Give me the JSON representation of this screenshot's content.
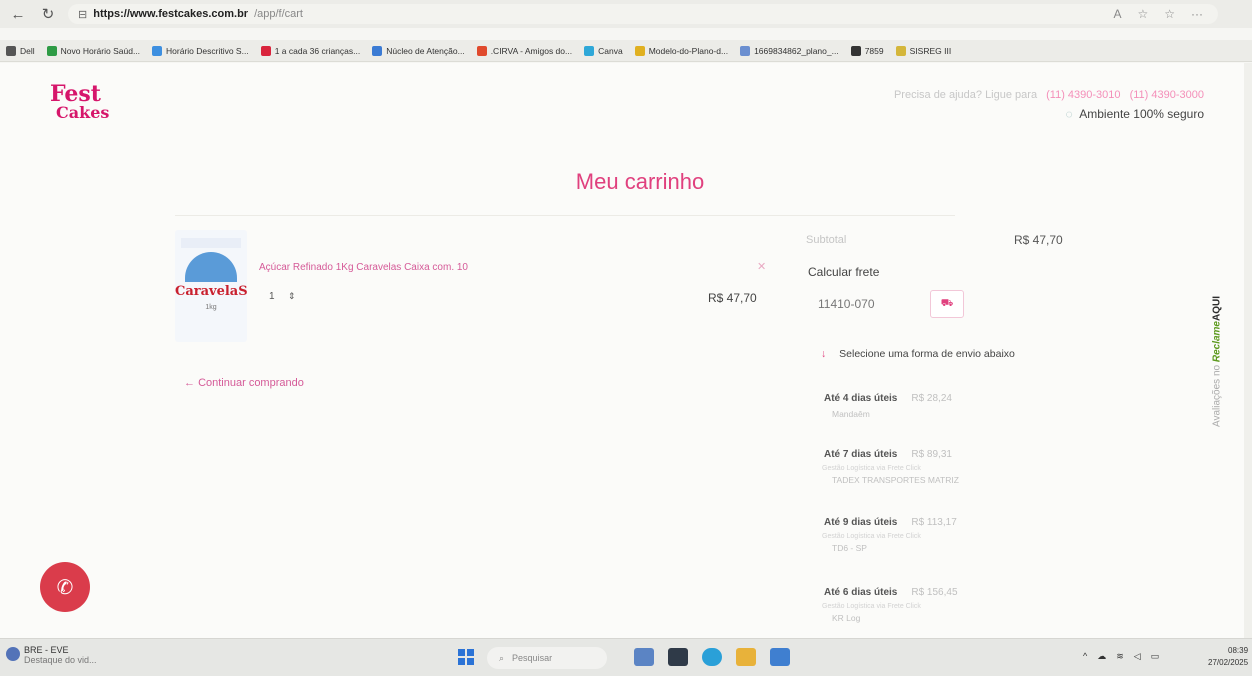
{
  "browser": {
    "url_host": "https://www.festcakes.com.br",
    "url_path": "/app/f/cart",
    "bookmarks": [
      {
        "label": "Dell",
        "color": "#555555"
      },
      {
        "label": "Novo Horário Saúd...",
        "color": "#2e9b45"
      },
      {
        "label": "Horário Descritivo S...",
        "color": "#3d8fe0"
      },
      {
        "label": "1 a cada 36 crianças...",
        "color": "#d9243c"
      },
      {
        "label": "Núcleo de Atenção...",
        "color": "#3b7bd4"
      },
      {
        "label": ".CIRVA - Amigos do...",
        "color": "#e04a2d"
      },
      {
        "label": "Canva",
        "color": "#2fa8d8"
      },
      {
        "label": "Modelo-do-Plano-d...",
        "color": "#e0b020"
      },
      {
        "label": "1669834862_plano_...",
        "color": "#6b8fd0"
      },
      {
        "label": "7859",
        "color": "#333333"
      },
      {
        "label": "SISREG III",
        "color": "#d4b63a"
      }
    ]
  },
  "header": {
    "logo_line1": "Fest",
    "logo_line2": "Cakes",
    "help_text": "Precisa de ajuda? Ligue para",
    "phone1": "(11) 4390-3010",
    "phone2": "(11) 4390-3000",
    "secure_text": "Ambiente 100% seguro"
  },
  "cart": {
    "title": "Meu carrinho",
    "product_brand": "CaravelaS",
    "product_name": "Açúcar Refinado 1Kg Caravelas Caixa com. 10",
    "quantity": "1",
    "price": "R$ 47,70",
    "continue_label": "Continuar comprando"
  },
  "summary": {
    "subtotal_label": "Subtotal",
    "subtotal_value": "R$ 47,70",
    "calc_label": "Calcular frete",
    "cep_value": "11410-070",
    "ship_hint": "Selecione uma forma de envio abaixo",
    "options": [
      {
        "days": "Até 4 dias úteis",
        "price": "R$ 28,24",
        "gestao": "",
        "carrier": "Mandaêm"
      },
      {
        "days": "Até 7 dias úteis",
        "price": "R$ 89,31",
        "gestao": "Gestão Logística via Frete Click",
        "carrier": "TADEX TRANSPORTES MATRIZ"
      },
      {
        "days": "Até 9 dias úteis",
        "price": "R$ 113,17",
        "gestao": "Gestão Logística via Frete Click",
        "carrier": "TD6 - SP"
      },
      {
        "days": "Até 6 dias úteis",
        "price": "R$ 156,45",
        "gestao": "Gestão Logística via Frete Click",
        "carrier": "KR Log"
      }
    ]
  },
  "reviews_tab": {
    "prefix": "Avaliações no",
    "brand": "Reclame",
    "suffix": "AQUI"
  },
  "taskbar": {
    "weather_title": "BRE - EVE",
    "weather_sub": "Destaque do vid...",
    "search_placeholder": "Pesquisar",
    "time": "08:39",
    "date": "27/02/2025"
  }
}
